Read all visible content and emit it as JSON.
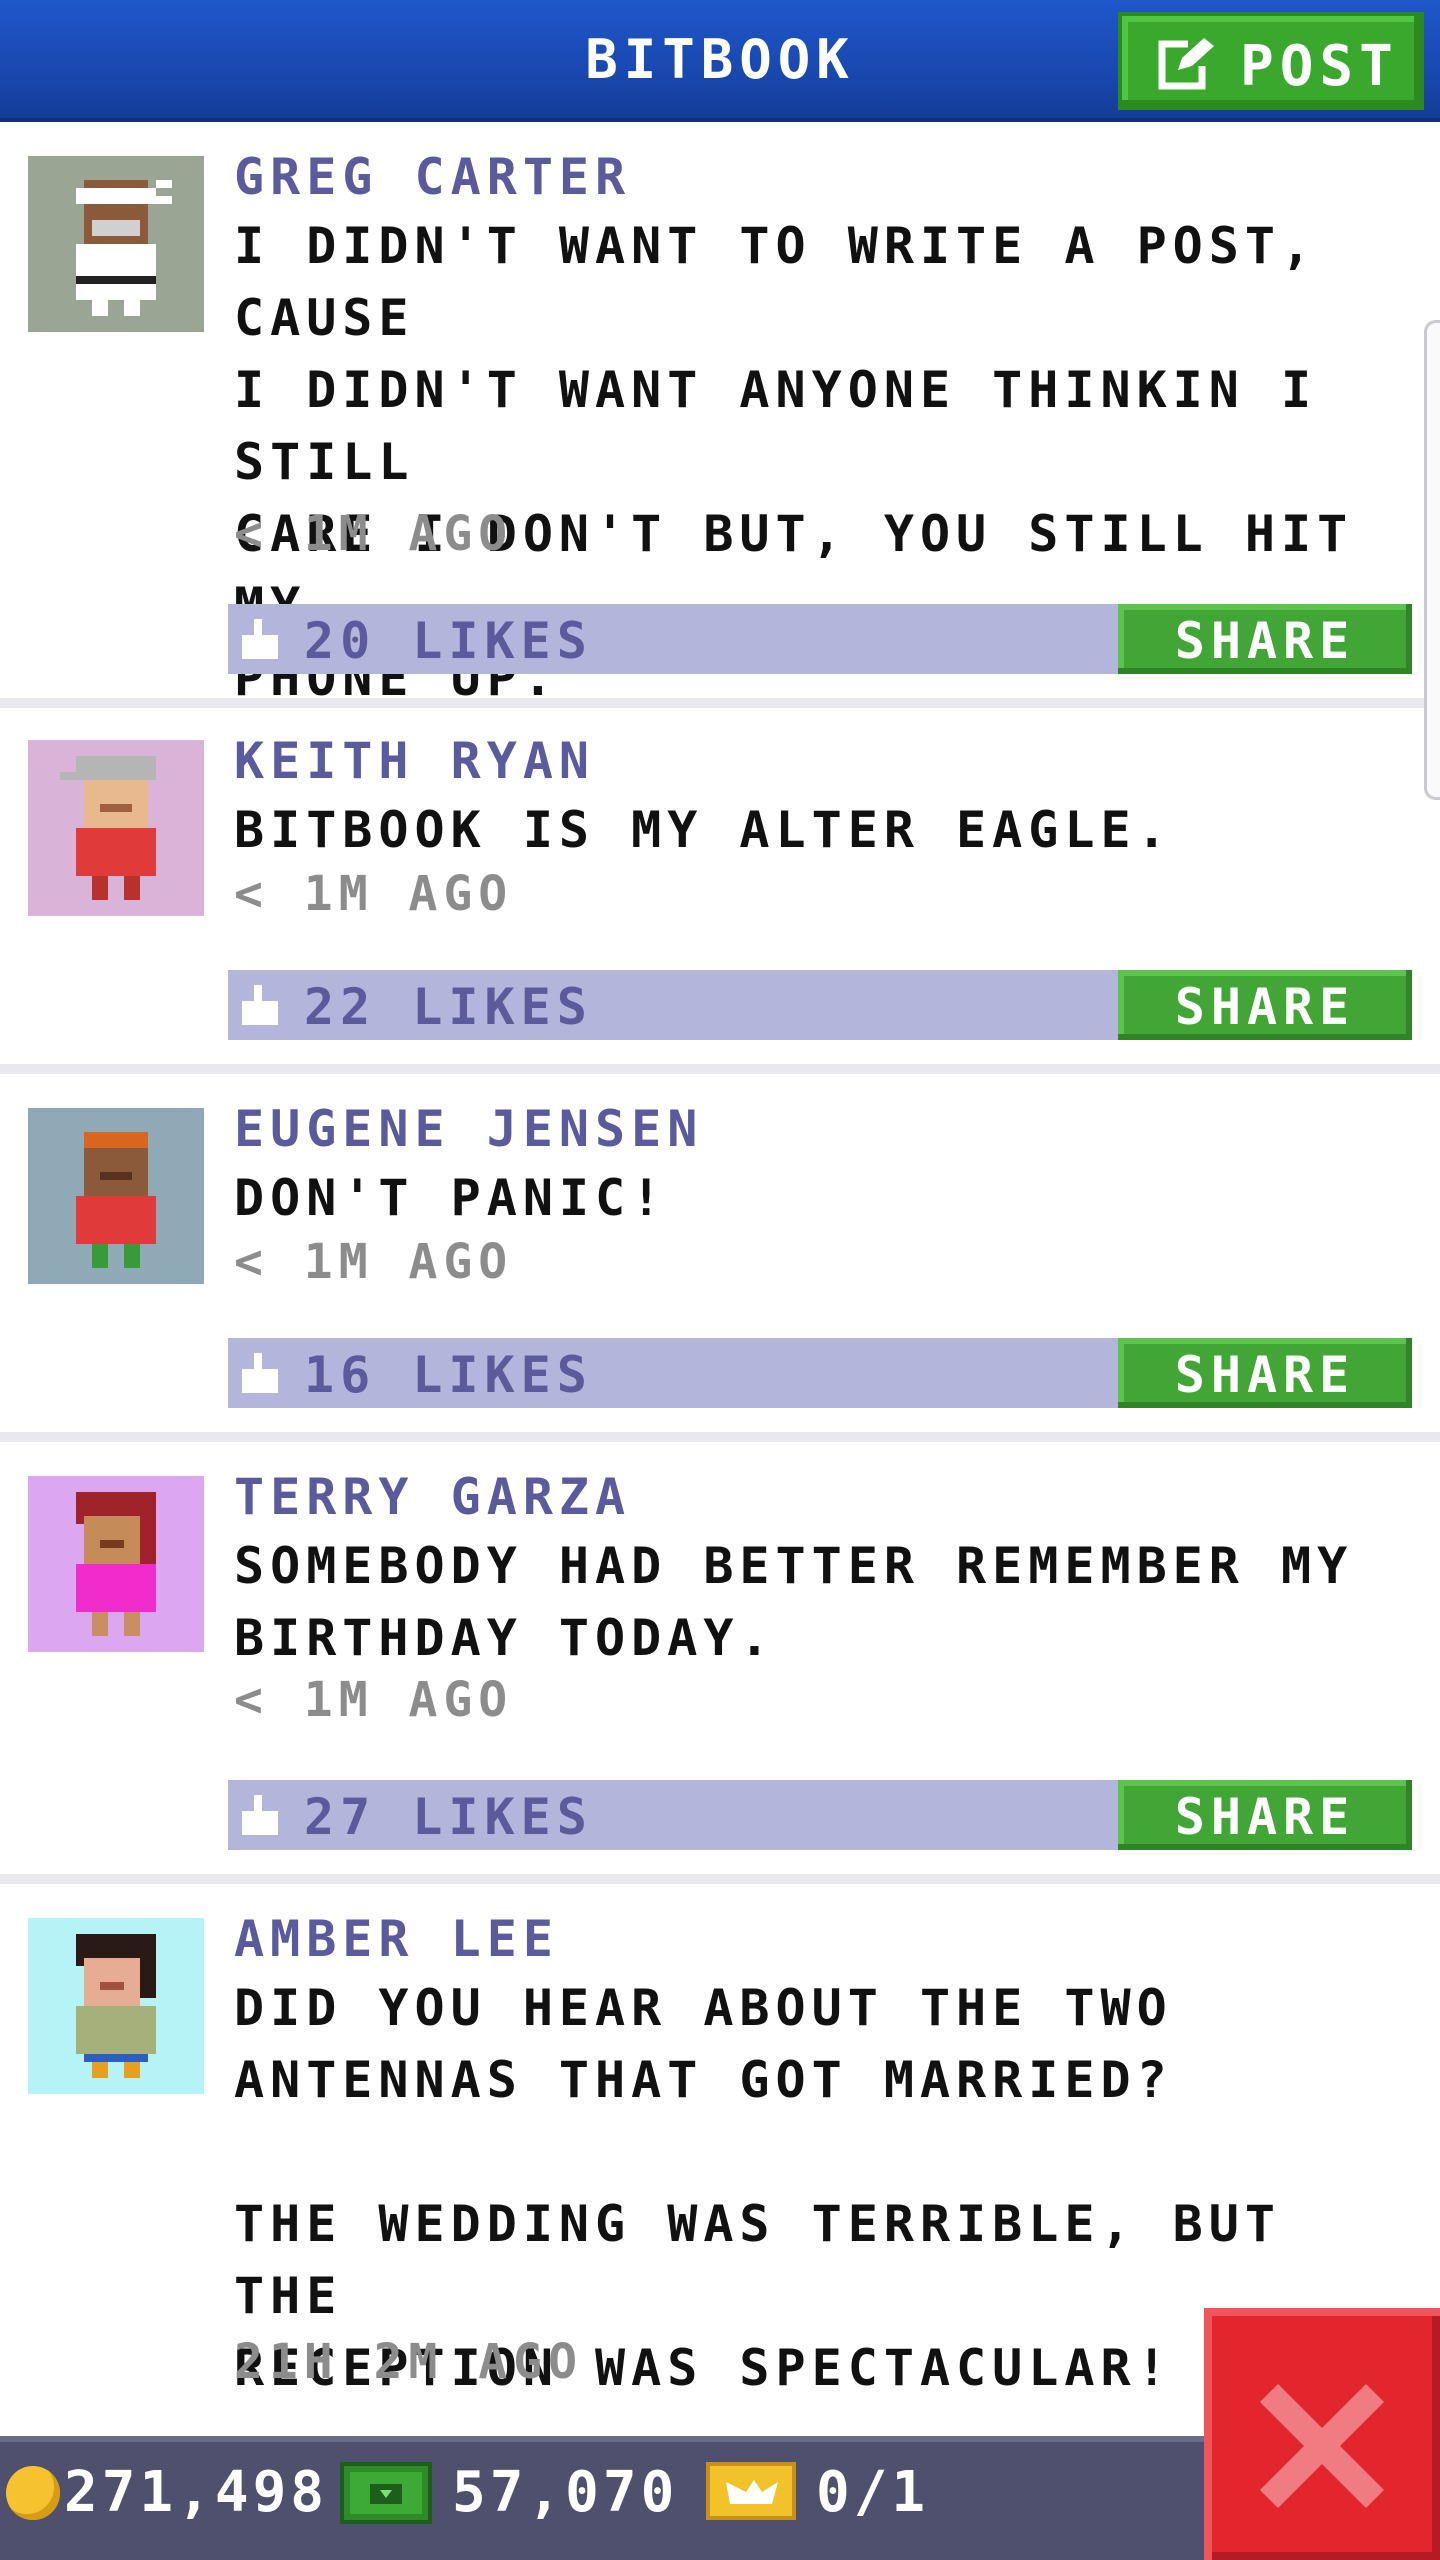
{
  "header": {
    "title": "BITBOOK",
    "post_label": "POST"
  },
  "posts": [
    {
      "author": "GREG CARTER",
      "body": "I DIDN'T WANT TO WRITE A POST, CAUSE\nI DIDN'T WANT ANYONE THINKIN I STILL\nCARE I DON'T BUT, YOU STILL HIT MY\nPHONE UP.",
      "time": "< 1M AGO",
      "likes": "20 LIKES",
      "share": "SHARE",
      "avatar_bg": "#9aa593"
    },
    {
      "author": "KEITH RYAN",
      "body": "BITBOOK IS MY ALTER EAGLE.",
      "time": "< 1M AGO",
      "likes": "22 LIKES",
      "share": "SHARE",
      "avatar_bg": "#d9b4d8"
    },
    {
      "author": "EUGENE JENSEN",
      "body": "DON'T PANIC!",
      "time": "< 1M AGO",
      "likes": "16 LIKES",
      "share": "SHARE",
      "avatar_bg": "#8fa9b7"
    },
    {
      "author": "TERRY GARZA",
      "body": "SOMEBODY HAD BETTER REMEMBER MY\nBIRTHDAY TODAY.",
      "time": "< 1M AGO",
      "likes": "27 LIKES",
      "share": "SHARE",
      "avatar_bg": "#dca6f0"
    },
    {
      "author": "AMBER LEE",
      "body": "DID YOU HEAR ABOUT THE TWO\nANTENNAS THAT GOT MARRIED?\n\nTHE WEDDING WAS TERRIBLE, BUT THE\nRECEPTION WAS SPECTACULAR!",
      "time": "21H 2M AGO",
      "avatar_bg": "#b6f3f7"
    }
  ],
  "footer": {
    "coins": "271,498",
    "bux": "57,070",
    "tickets": "0/1"
  },
  "icons": [
    "edit-icon",
    "thumbs-up-icon",
    "coin-icon",
    "bux-icon",
    "ticket-icon",
    "close-icon"
  ],
  "colors": {
    "header": "#1a4bb5",
    "green": "#42a636",
    "likebar": "#b3b5da",
    "author": "#5b5a9c",
    "close": "#e3262e"
  }
}
